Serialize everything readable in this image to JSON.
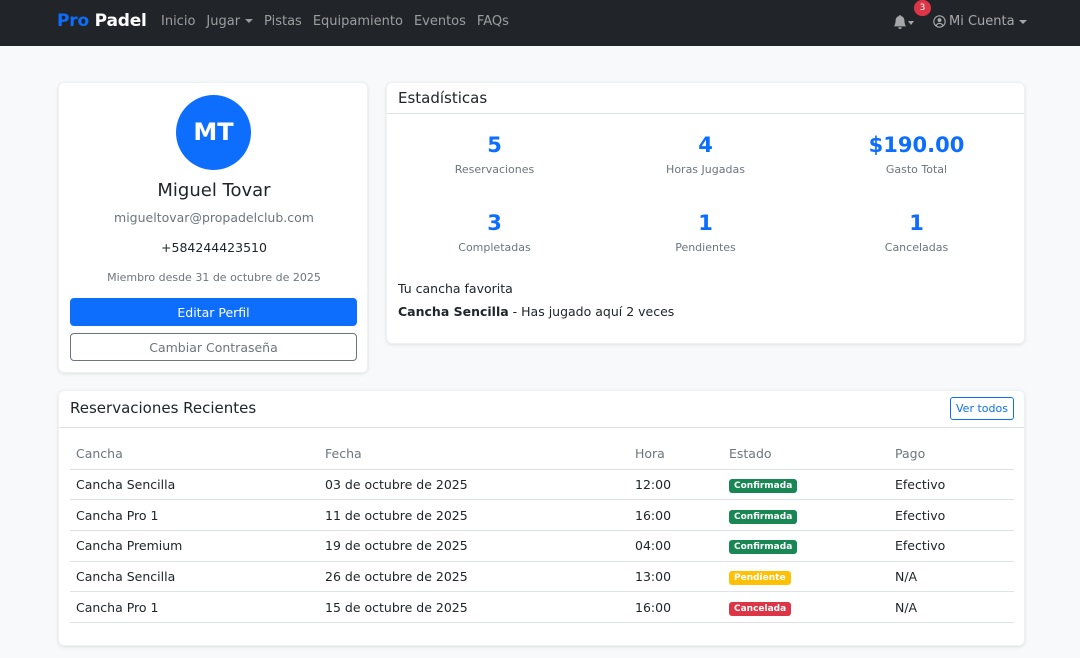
{
  "navbar": {
    "brand_part1": "Pro",
    "brand_part2": "Padel",
    "links": [
      "Inicio",
      "Jugar",
      "Pistas",
      "Equipamiento",
      "Eventos",
      "FAQs"
    ],
    "notifications_count": "3",
    "account_label": "Mi Cuenta"
  },
  "profile": {
    "initials": "MT",
    "name": "Miguel Tovar",
    "email": "migueltovar@propadelclub.com",
    "phone": "+584244423510",
    "member_since": "Miembro desde 31 de octubre de 2025",
    "edit_button": "Editar Perfil",
    "password_button": "Cambiar Contraseña"
  },
  "stats": {
    "title": "Estadísticas",
    "items": [
      {
        "value": "5",
        "label": "Reservaciones"
      },
      {
        "value": "4",
        "label": "Horas Jugadas"
      },
      {
        "value": "$190.00",
        "label": "Gasto Total"
      },
      {
        "value": "3",
        "label": "Completadas"
      },
      {
        "value": "1",
        "label": "Pendientes"
      },
      {
        "value": "1",
        "label": "Canceladas"
      }
    ],
    "favorite_label": "Tu cancha favorita",
    "favorite_court": "Cancha Sencilla",
    "favorite_detail": " - Has jugado aquí 2 veces"
  },
  "reservations": {
    "title": "Reservaciones Recientes",
    "view_all": "Ver todos",
    "columns": [
      "Cancha",
      "Fecha",
      "Hora",
      "Estado",
      "Pago"
    ],
    "rows": [
      {
        "court": "Cancha Sencilla",
        "date": "03 de octubre de 2025",
        "time": "12:00",
        "status": "Confirmada",
        "status_type": "success",
        "payment": "Efectivo"
      },
      {
        "court": "Cancha Pro 1",
        "date": "11 de octubre de 2025",
        "time": "16:00",
        "status": "Confirmada",
        "status_type": "success",
        "payment": "Efectivo"
      },
      {
        "court": "Cancha Premium",
        "date": "19 de octubre de 2025",
        "time": "04:00",
        "status": "Confirmada",
        "status_type": "success",
        "payment": "Efectivo"
      },
      {
        "court": "Cancha Sencilla",
        "date": "26 de octubre de 2025",
        "time": "13:00",
        "status": "Pendiente",
        "status_type": "warning",
        "payment": "N/A"
      },
      {
        "court": "Cancha Pro 1",
        "date": "15 de octubre de 2025",
        "time": "16:00",
        "status": "Cancelada",
        "status_type": "danger",
        "payment": "N/A"
      }
    ]
  },
  "colors": {
    "primary": "#0d6efd",
    "navbar_bg": "#212529",
    "success": "#198754",
    "warning": "#ffc107",
    "danger": "#dc3545"
  }
}
